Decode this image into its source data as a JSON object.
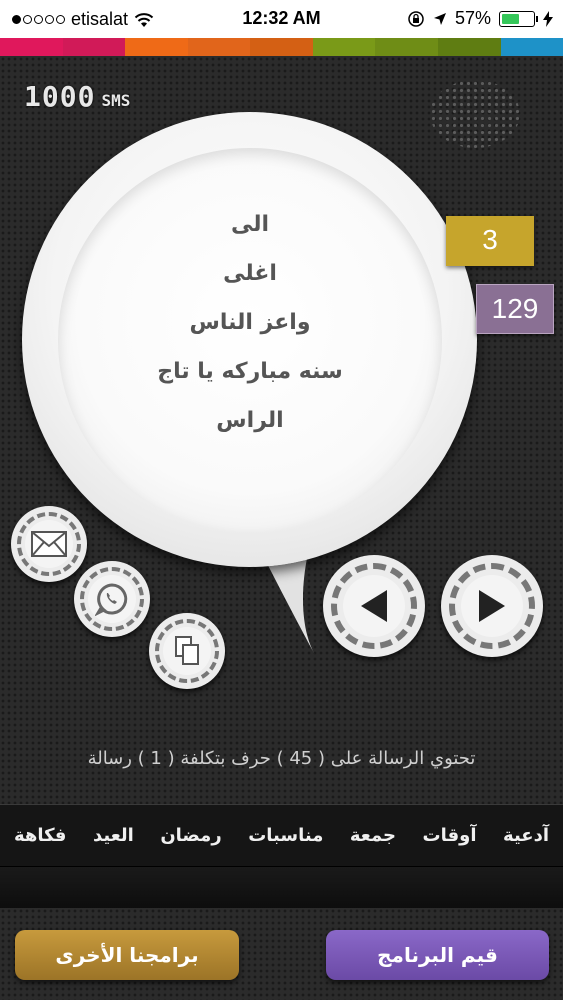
{
  "status_bar": {
    "carrier": "etisalat",
    "time": "12:32 AM",
    "battery_percent": "57%",
    "battery_level": 0.57,
    "signal_bars_filled": 1,
    "signal_bars_total": 5
  },
  "colors": {
    "stripe": [
      "#e0185c",
      "#d11a58",
      "#ef6a17",
      "#e1651b",
      "#d46014",
      "#7a9a18",
      "#6f8d16",
      "#5f7d12",
      "#1e92c8"
    ],
    "tag_yellow": "#c6a52c",
    "tag_purple": "#8a7094",
    "button_gold": "#b4883a",
    "button_violet": "#7a59b8"
  },
  "counter": {
    "value": "1000",
    "unit": "SMS"
  },
  "message": {
    "lines": [
      "الى",
      "اغلى",
      "واعز الناس",
      "سنه مباركه يا تاج",
      "الراس"
    ]
  },
  "tags": {
    "current": "3",
    "total": "129"
  },
  "icons": {
    "email": "envelope-icon",
    "whatsapp": "whatsapp-icon",
    "copy": "copy-icon",
    "previous": "triangle-left-icon",
    "next": "triangle-right-icon"
  },
  "info_text": "تحتوي الرسالة على ( 45 ) حرف بتكلفة ( 1 ) رسالة",
  "categories": [
    "آدعية",
    "آوقات",
    "جمعة",
    "مناسبات",
    "رمضان",
    "العيد",
    "فكاهة"
  ],
  "buttons": {
    "rate_app": "قيم البرنامج",
    "other_apps": "برامجنا الأخرى"
  }
}
